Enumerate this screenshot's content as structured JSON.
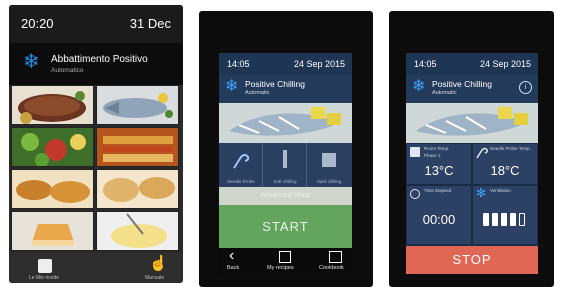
{
  "device1": {
    "time": "20:20",
    "date": "31 Dec",
    "title": "Abbattimento Positivo",
    "subtitle": "Automatico",
    "footer_left_label": "Le Mie ricette",
    "footer_right_label": "Manuale"
  },
  "device2": {
    "time": "14:05",
    "date": "24 Sep 2015",
    "title": "Positive Chilling",
    "subtitle": "Automatic",
    "icons": [
      "Needle Probe",
      "Soft chilling",
      "Hard chilling"
    ],
    "advanced": "Advanced Mode",
    "start": "START",
    "nav": [
      "Back",
      "My recipes",
      "Cookbook"
    ]
  },
  "device3": {
    "time": "14:05",
    "date": "24 Sep 2015",
    "title": "Positive Chilling",
    "subtitle": "Automatic",
    "room_temp_label": "Room Temp.",
    "phase_label": "Phase 1",
    "room_temp": "13°C",
    "needle_label": "Needle Probe Temp.",
    "needle_temp": "18°C",
    "time_label": "Time Elapsed",
    "time_elapsed": "00:00",
    "vent_label": "Ventilation",
    "stop": "STOP"
  },
  "colors": {
    "accent_blue": "#1e8fe6",
    "start_green": "#63a45f",
    "stop_red": "#e06656",
    "screen_navy": "#1f3554"
  }
}
